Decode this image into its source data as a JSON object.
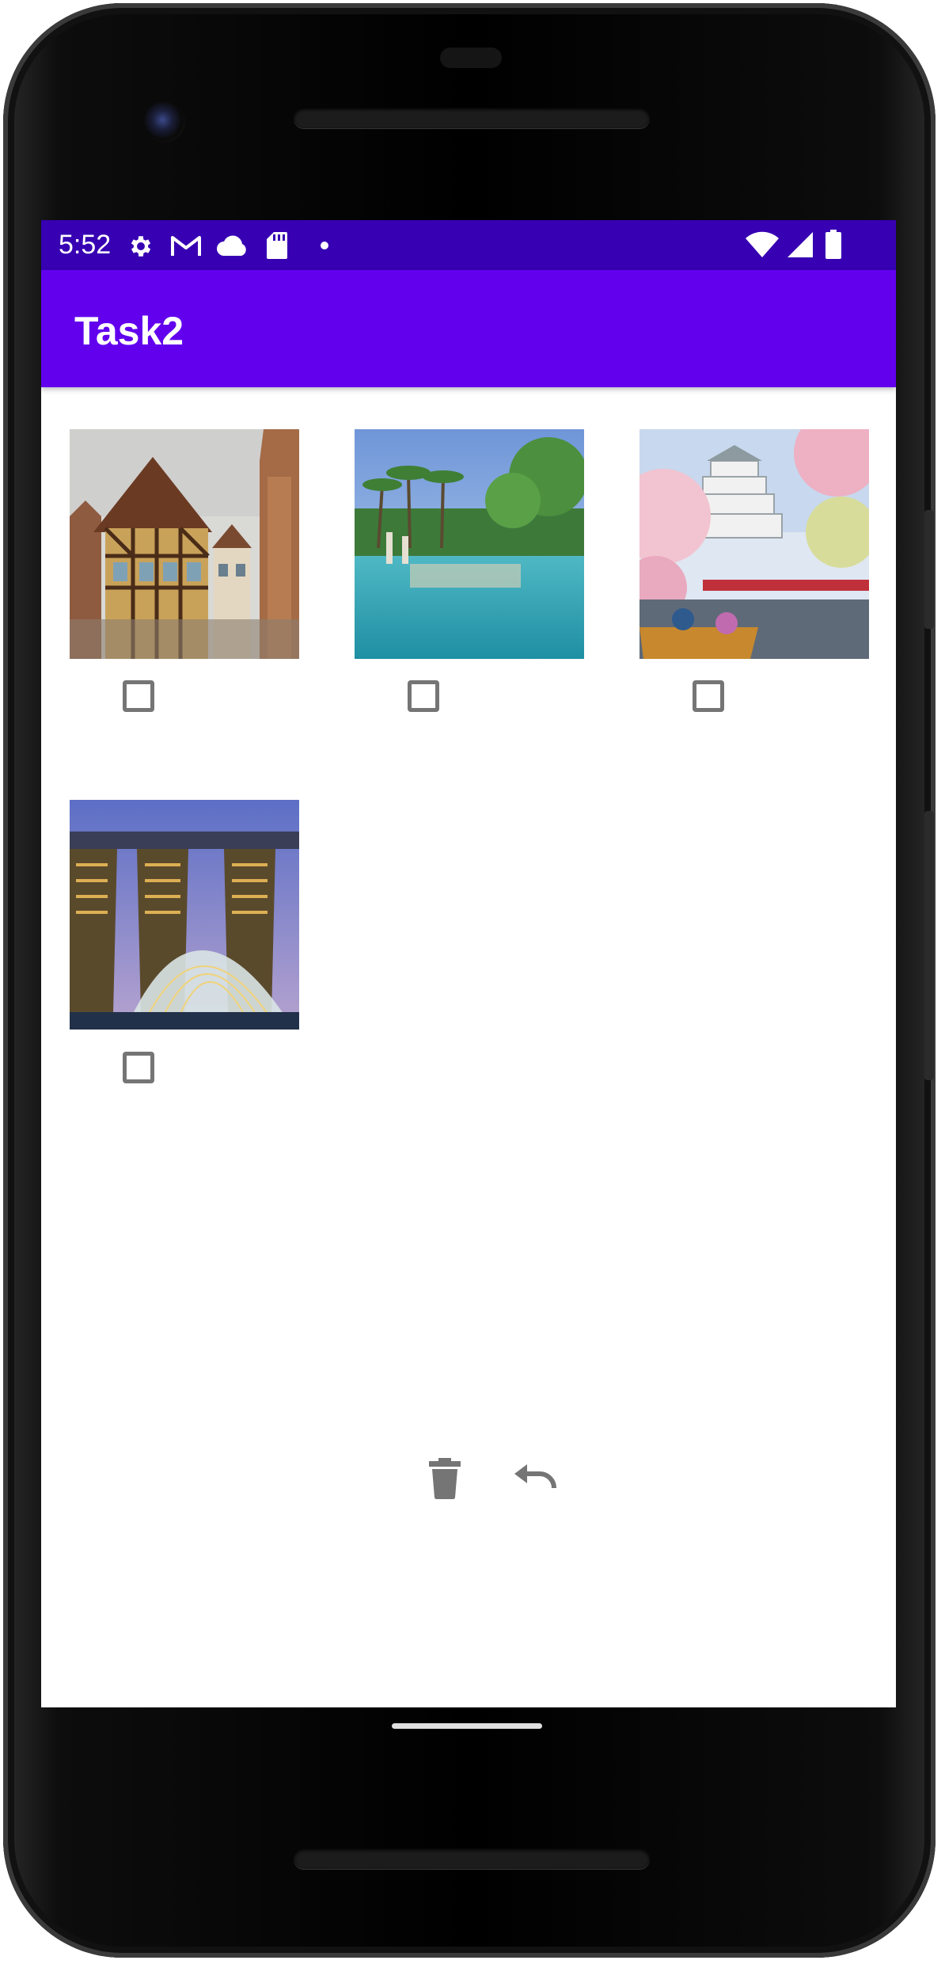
{
  "status_bar": {
    "time": "5:52",
    "left_icons": [
      "gear-icon",
      "gmail-icon",
      "cloud-icon",
      "sd-card-icon",
      "dot-icon"
    ],
    "right_icons": [
      "wifi-icon",
      "cell-signal-icon",
      "battery-icon"
    ],
    "background": "#3700b3"
  },
  "app_bar": {
    "title": "Task2",
    "background": "#6200ee"
  },
  "gallery": {
    "items": [
      {
        "image": "half-timbered-town-photo",
        "checked": false
      },
      {
        "image": "tropical-pool-resort-photo",
        "checked": false
      },
      {
        "image": "castle-cherry-blossom-photo",
        "checked": false
      },
      {
        "image": "singapore-marina-skyline-photo",
        "checked": false
      }
    ]
  },
  "actions": {
    "delete_icon": "trash-icon",
    "undo_icon": "undo-icon",
    "icon_color": "#757575"
  }
}
